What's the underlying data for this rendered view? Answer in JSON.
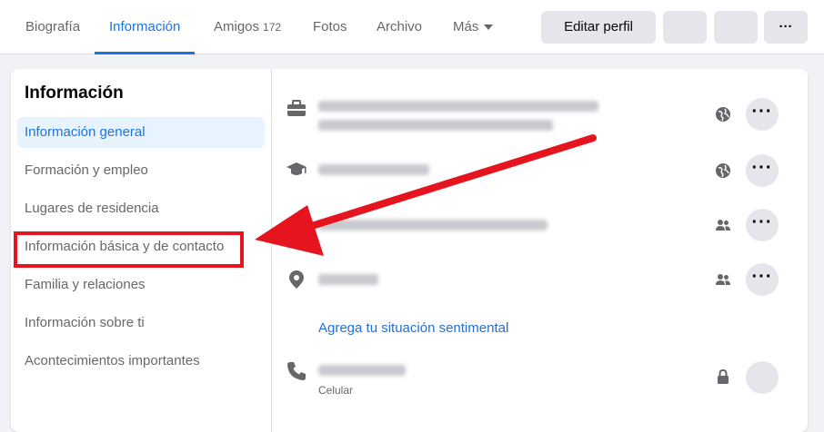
{
  "tabs": [
    {
      "label": "Biografía"
    },
    {
      "label": "Información"
    },
    {
      "label": "Amigos",
      "count": "172"
    },
    {
      "label": "Fotos"
    },
    {
      "label": "Archivo"
    },
    {
      "label": "Más"
    }
  ],
  "header": {
    "edit_profile": "Editar perfil",
    "more": "···"
  },
  "sidebar": {
    "title": "Información",
    "items": [
      {
        "label": "Información general"
      },
      {
        "label": "Formación y empleo"
      },
      {
        "label": "Lugares de residencia"
      },
      {
        "label": "Información básica y de contacto"
      },
      {
        "label": "Familia y relaciones"
      },
      {
        "label": "Información sobre ti"
      },
      {
        "label": "Acontecimientos importantes"
      }
    ]
  },
  "main": {
    "relationship_link": "Agrega tu situación sentimental",
    "phone_label": "Celular",
    "more_label": "···"
  },
  "colors": {
    "accent": "#1b74e4",
    "annotation": "#e5141f"
  }
}
